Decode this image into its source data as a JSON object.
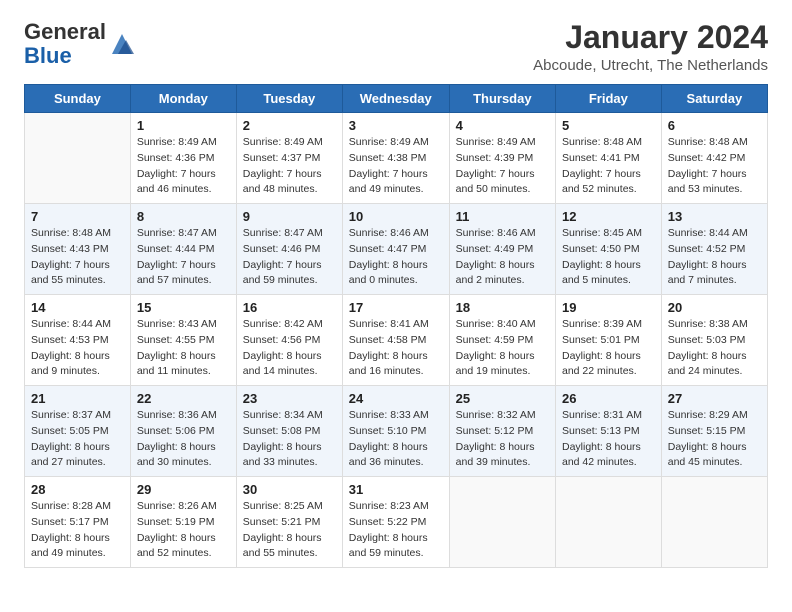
{
  "header": {
    "logo_general": "General",
    "logo_blue": "Blue",
    "month_year": "January 2024",
    "location": "Abcoude, Utrecht, The Netherlands"
  },
  "days_of_week": [
    "Sunday",
    "Monday",
    "Tuesday",
    "Wednesday",
    "Thursday",
    "Friday",
    "Saturday"
  ],
  "weeks": [
    [
      {
        "day": "",
        "info": ""
      },
      {
        "day": "1",
        "info": "Sunrise: 8:49 AM\nSunset: 4:36 PM\nDaylight: 7 hours\nand 46 minutes."
      },
      {
        "day": "2",
        "info": "Sunrise: 8:49 AM\nSunset: 4:37 PM\nDaylight: 7 hours\nand 48 minutes."
      },
      {
        "day": "3",
        "info": "Sunrise: 8:49 AM\nSunset: 4:38 PM\nDaylight: 7 hours\nand 49 minutes."
      },
      {
        "day": "4",
        "info": "Sunrise: 8:49 AM\nSunset: 4:39 PM\nDaylight: 7 hours\nand 50 minutes."
      },
      {
        "day": "5",
        "info": "Sunrise: 8:48 AM\nSunset: 4:41 PM\nDaylight: 7 hours\nand 52 minutes."
      },
      {
        "day": "6",
        "info": "Sunrise: 8:48 AM\nSunset: 4:42 PM\nDaylight: 7 hours\nand 53 minutes."
      }
    ],
    [
      {
        "day": "7",
        "info": "Sunrise: 8:48 AM\nSunset: 4:43 PM\nDaylight: 7 hours\nand 55 minutes."
      },
      {
        "day": "8",
        "info": "Sunrise: 8:47 AM\nSunset: 4:44 PM\nDaylight: 7 hours\nand 57 minutes."
      },
      {
        "day": "9",
        "info": "Sunrise: 8:47 AM\nSunset: 4:46 PM\nDaylight: 7 hours\nand 59 minutes."
      },
      {
        "day": "10",
        "info": "Sunrise: 8:46 AM\nSunset: 4:47 PM\nDaylight: 8 hours\nand 0 minutes."
      },
      {
        "day": "11",
        "info": "Sunrise: 8:46 AM\nSunset: 4:49 PM\nDaylight: 8 hours\nand 2 minutes."
      },
      {
        "day": "12",
        "info": "Sunrise: 8:45 AM\nSunset: 4:50 PM\nDaylight: 8 hours\nand 5 minutes."
      },
      {
        "day": "13",
        "info": "Sunrise: 8:44 AM\nSunset: 4:52 PM\nDaylight: 8 hours\nand 7 minutes."
      }
    ],
    [
      {
        "day": "14",
        "info": "Sunrise: 8:44 AM\nSunset: 4:53 PM\nDaylight: 8 hours\nand 9 minutes."
      },
      {
        "day": "15",
        "info": "Sunrise: 8:43 AM\nSunset: 4:55 PM\nDaylight: 8 hours\nand 11 minutes."
      },
      {
        "day": "16",
        "info": "Sunrise: 8:42 AM\nSunset: 4:56 PM\nDaylight: 8 hours\nand 14 minutes."
      },
      {
        "day": "17",
        "info": "Sunrise: 8:41 AM\nSunset: 4:58 PM\nDaylight: 8 hours\nand 16 minutes."
      },
      {
        "day": "18",
        "info": "Sunrise: 8:40 AM\nSunset: 4:59 PM\nDaylight: 8 hours\nand 19 minutes."
      },
      {
        "day": "19",
        "info": "Sunrise: 8:39 AM\nSunset: 5:01 PM\nDaylight: 8 hours\nand 22 minutes."
      },
      {
        "day": "20",
        "info": "Sunrise: 8:38 AM\nSunset: 5:03 PM\nDaylight: 8 hours\nand 24 minutes."
      }
    ],
    [
      {
        "day": "21",
        "info": "Sunrise: 8:37 AM\nSunset: 5:05 PM\nDaylight: 8 hours\nand 27 minutes."
      },
      {
        "day": "22",
        "info": "Sunrise: 8:36 AM\nSunset: 5:06 PM\nDaylight: 8 hours\nand 30 minutes."
      },
      {
        "day": "23",
        "info": "Sunrise: 8:34 AM\nSunset: 5:08 PM\nDaylight: 8 hours\nand 33 minutes."
      },
      {
        "day": "24",
        "info": "Sunrise: 8:33 AM\nSunset: 5:10 PM\nDaylight: 8 hours\nand 36 minutes."
      },
      {
        "day": "25",
        "info": "Sunrise: 8:32 AM\nSunset: 5:12 PM\nDaylight: 8 hours\nand 39 minutes."
      },
      {
        "day": "26",
        "info": "Sunrise: 8:31 AM\nSunset: 5:13 PM\nDaylight: 8 hours\nand 42 minutes."
      },
      {
        "day": "27",
        "info": "Sunrise: 8:29 AM\nSunset: 5:15 PM\nDaylight: 8 hours\nand 45 minutes."
      }
    ],
    [
      {
        "day": "28",
        "info": "Sunrise: 8:28 AM\nSunset: 5:17 PM\nDaylight: 8 hours\nand 49 minutes."
      },
      {
        "day": "29",
        "info": "Sunrise: 8:26 AM\nSunset: 5:19 PM\nDaylight: 8 hours\nand 52 minutes."
      },
      {
        "day": "30",
        "info": "Sunrise: 8:25 AM\nSunset: 5:21 PM\nDaylight: 8 hours\nand 55 minutes."
      },
      {
        "day": "31",
        "info": "Sunrise: 8:23 AM\nSunset: 5:22 PM\nDaylight: 8 hours\nand 59 minutes."
      },
      {
        "day": "",
        "info": ""
      },
      {
        "day": "",
        "info": ""
      },
      {
        "day": "",
        "info": ""
      }
    ]
  ]
}
